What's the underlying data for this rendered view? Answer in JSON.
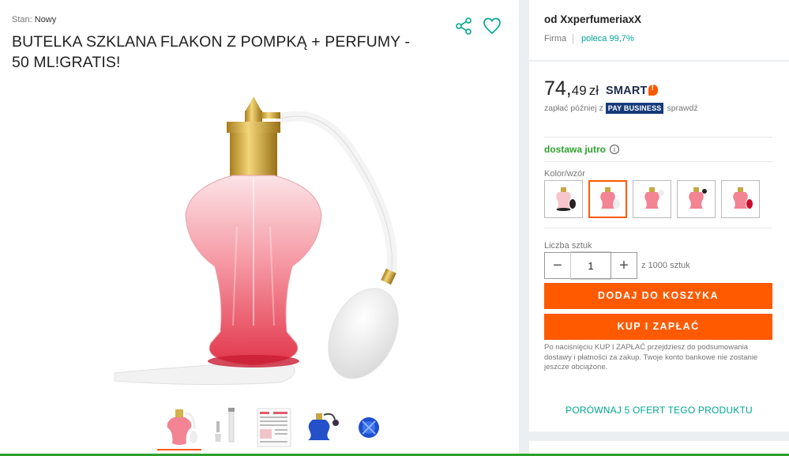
{
  "product": {
    "condition_label": "Stan:",
    "condition_value": "Nowy",
    "title": "BUTELKA SZKLANA FLAKON Z POMPKĄ + PERFUMY - 50 ML!GRATIS!"
  },
  "icons": {
    "share": "share-icon",
    "favorite": "heart-icon"
  },
  "thumbnails": [
    {
      "name": "thumb-pink-bottle",
      "active": true
    },
    {
      "name": "thumb-atomizer-parts",
      "active": false
    },
    {
      "name": "thumb-instructions",
      "active": false
    },
    {
      "name": "thumb-blue-bottle",
      "active": false
    },
    {
      "name": "thumb-blue-cap",
      "active": false
    }
  ],
  "seller": {
    "prefix": "od",
    "name": "XxperfumeriaxX",
    "type": "Firma",
    "rating": "poleca 99,7%"
  },
  "offer": {
    "price_main": "74,",
    "price_cents": "49",
    "currency": "zł",
    "smart": "SMART",
    "pay_later_pre": "zapłać później z",
    "pay_business": "PAY BUSINESS",
    "pay_later_link": "sprawdź",
    "delivery": "dostawa jutro",
    "variant_label": "Kolor/wzór",
    "variants": [
      {
        "color": "#222222",
        "selected": false
      },
      {
        "color": "#ff7a8a",
        "selected": true
      },
      {
        "color": "#ff7a8a",
        "selected": false
      },
      {
        "color": "#ff7a8a",
        "selected": false
      },
      {
        "color": "#c8102e",
        "selected": false
      }
    ],
    "qty_label": "Liczba sztuk",
    "qty_value": "1",
    "qty_max": "z 1000 sztuk",
    "add_to_cart": "DODAJ DO KOSZYKA",
    "buy_now": "KUP I ZAPŁAĆ",
    "disclaimer": "Po naciśnięciu KUP I ZAPŁAĆ przejdziesz do podsumowania dostawy i płatności za zakup. Twoje konto bankowe nie zostanie jeszcze obciążone.",
    "compare": "PORÓWNAJ 5 OFERT TEGO PRODUKTU"
  },
  "colors": {
    "accent": "#ff5a00",
    "teal": "#00a790",
    "green": "#2ea12c"
  }
}
